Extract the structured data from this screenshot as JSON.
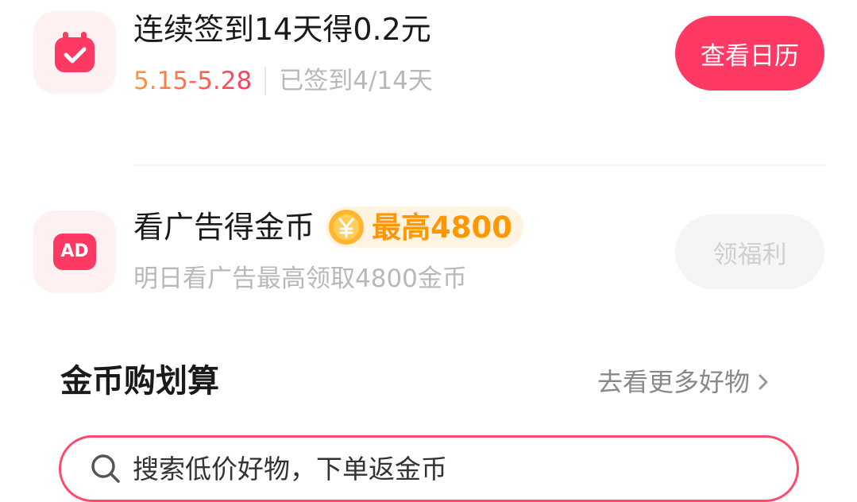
{
  "signin_task": {
    "title": "连续签到14天得0.2元",
    "date_range": "5.15-5.28",
    "progress": "已签到4/14天",
    "button_label": "查看日历",
    "icon": "calendar-check-icon"
  },
  "ad_task": {
    "title": "看广告得金币",
    "badge_label": "最高4800",
    "badge_icon": "yuan-coin-icon",
    "subtitle": "明日看广告最高领取4800金币",
    "button_label": "领福利",
    "icon_text": "AD"
  },
  "deals_section": {
    "title": "金币购划算",
    "more_label": "去看更多好物"
  },
  "search": {
    "placeholder": "搜索低价好物，下单返金币"
  },
  "colors": {
    "accent": "#fe3a64",
    "date_gradient_start": "#ff9a3c",
    "date_gradient_end": "#fe3a64",
    "badge_gold": "#ff9800"
  }
}
